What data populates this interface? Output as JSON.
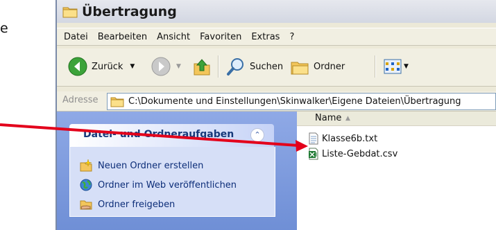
{
  "page": {
    "fragment": "e"
  },
  "window": {
    "title": "Übertragung"
  },
  "menu": [
    "Datei",
    "Bearbeiten",
    "Ansicht",
    "Favoriten",
    "Extras",
    "?"
  ],
  "toolbar": {
    "back_label": "Zurück",
    "search_label": "Suchen",
    "folders_label": "Ordner"
  },
  "address": {
    "label": "Adresse",
    "path": "C:\\Dokumente und Einstellungen\\Skinwalker\\Eigene Dateien\\Übertragung"
  },
  "tasks": {
    "header": "Datei- und Ordneraufgaben",
    "items": [
      "Neuen Ordner erstellen",
      "Ordner im Web veröffentlichen",
      "Ordner freigeben"
    ]
  },
  "files": {
    "column_name": "Name",
    "items": [
      "Klasse6b.txt",
      "Liste-Gebdat.csv"
    ]
  },
  "colors": {
    "annotation_arrow": "#e3001b",
    "task_pane": "#7a96dc"
  }
}
